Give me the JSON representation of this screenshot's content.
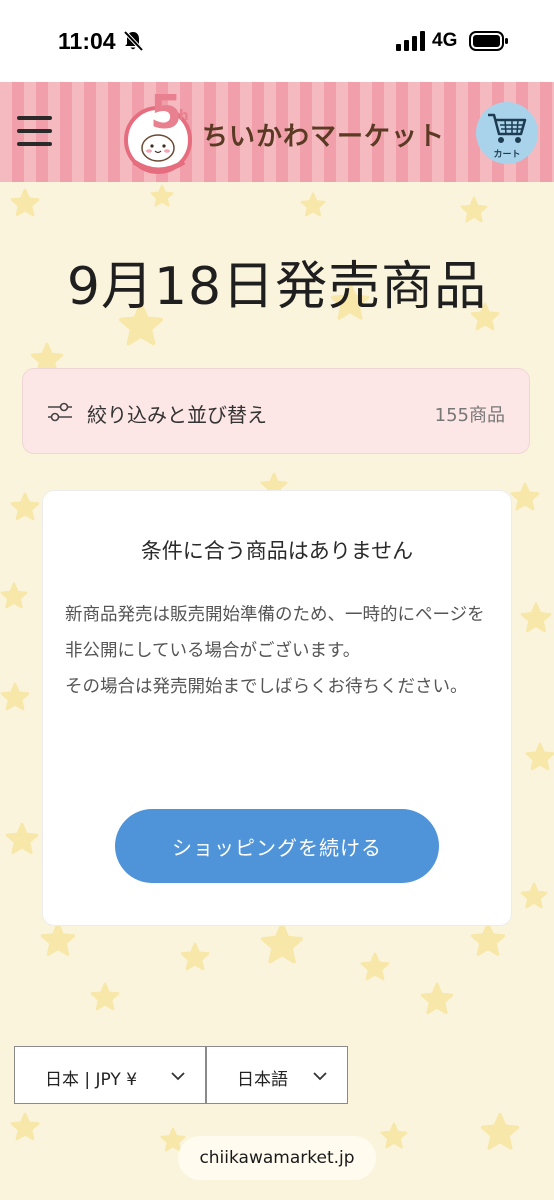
{
  "status_bar": {
    "time": "11:04",
    "network": "4G"
  },
  "header": {
    "logo_badge_number": "5",
    "logo_badge_suffix": "th",
    "logo_text": "ちいかわマーケット",
    "cart_label": "カート"
  },
  "page": {
    "title": "9月18日発売商品"
  },
  "filter": {
    "label": "絞り込みと並び替え",
    "count": "155商品"
  },
  "empty_state": {
    "title": "条件に合う商品はありません",
    "paragraph_1": "新商品発売は販売開始準備のため、一時的にページを非公開にしている場合がございます。",
    "paragraph_2": "その場合は発売開始までしばらくお待ちください。",
    "button_label": "ショッピングを続ける"
  },
  "footer": {
    "country_currency": "日本 | JPY ¥",
    "language": "日本語"
  },
  "browser": {
    "url": "chiikawamarket.jp"
  },
  "colors": {
    "header_stripe_light": "#f5b9c0",
    "header_stripe_dark": "#f09fab",
    "page_background": "#fbf4dc",
    "star": "#f7e7a8",
    "filter_background": "#fde7e6",
    "button_blue": "#4f94d9",
    "cart_circle": "#a9d3ea"
  }
}
